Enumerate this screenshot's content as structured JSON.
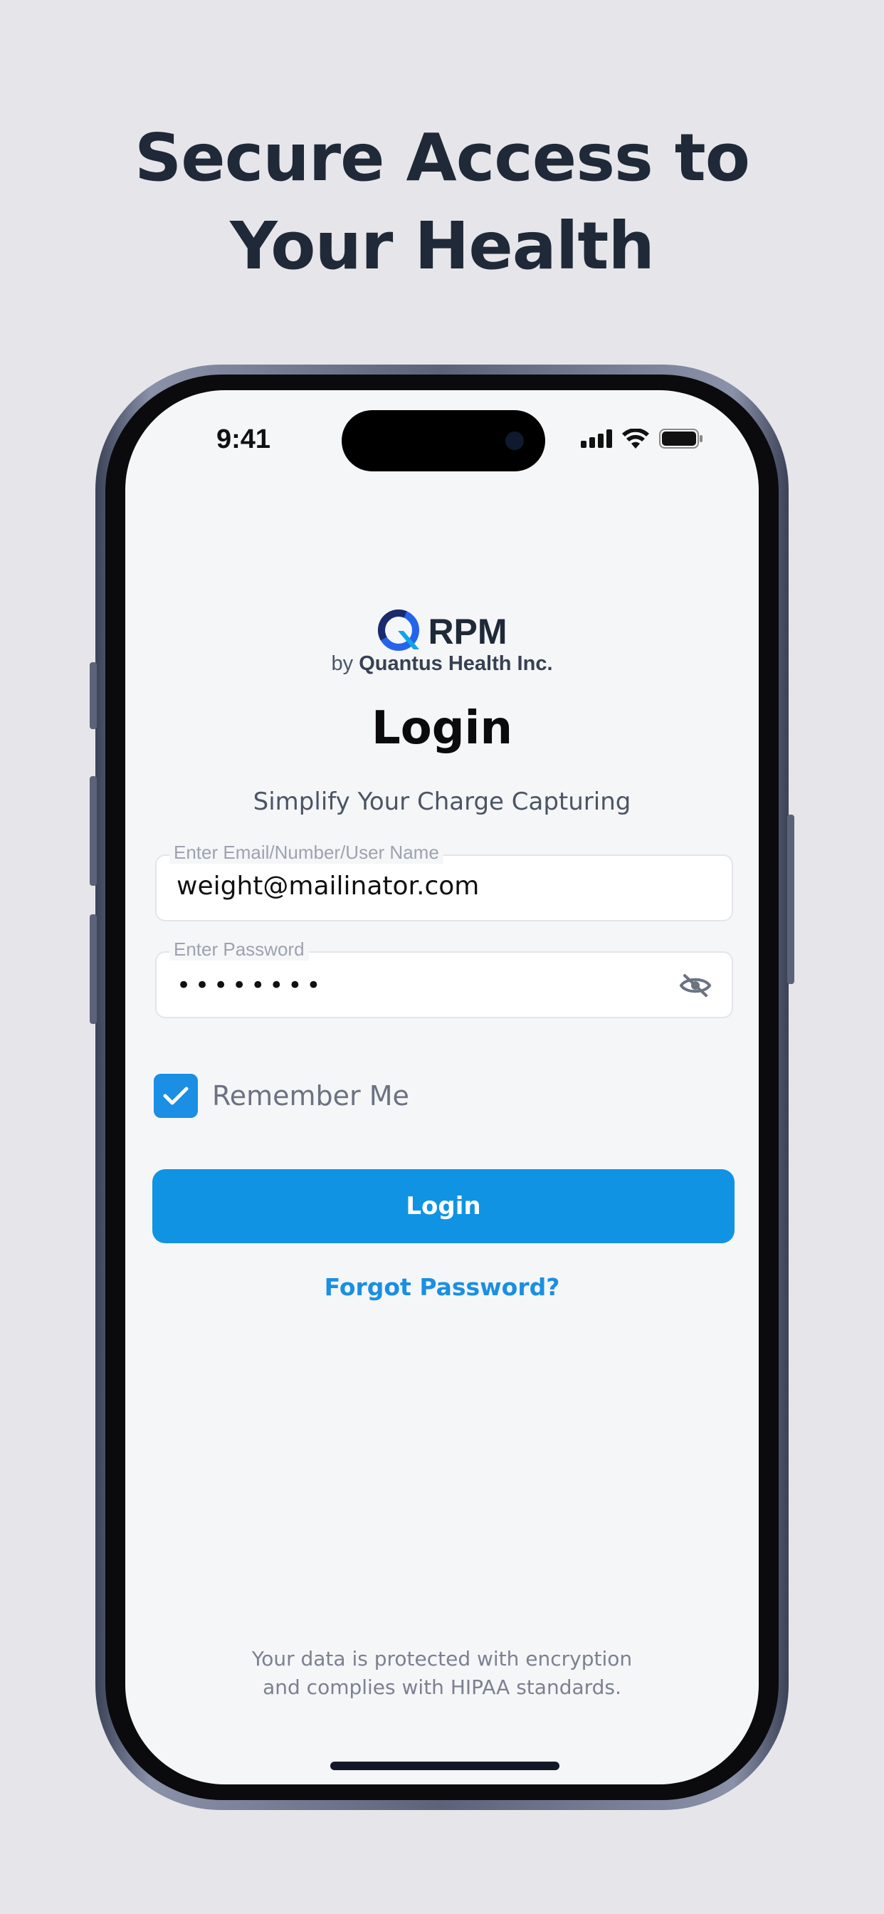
{
  "headline": {
    "line1": "Secure Access to",
    "line2": "Your Health"
  },
  "status_bar": {
    "time": "9:41",
    "icons": [
      "signal-icon",
      "wifi-icon",
      "battery-icon"
    ]
  },
  "brand": {
    "logo_icon": "quantus-q-icon",
    "name": "RPM",
    "by_prefix": "by",
    "company": "Quantus Health Inc."
  },
  "login": {
    "title": "Login",
    "subtitle": "Simplify Your Charge Capturing",
    "email_label": "Enter Email/Number/User Name",
    "email_value": "weight@mailinator.com",
    "password_label": "Enter Password",
    "password_value": "••••••••",
    "password_toggle_icon": "eye-slash-icon",
    "remember_label": "Remember Me",
    "remember_checked": true,
    "button_label": "Login",
    "forgot_label": "Forgot Password?"
  },
  "footer": {
    "line1": "Your data is protected with encryption",
    "line2": "and complies with HIPAA standards."
  },
  "colors": {
    "accent": "#1193e4",
    "background": "#e6e6ea",
    "screen": "#f5f6f8",
    "headline": "#1f2937"
  }
}
